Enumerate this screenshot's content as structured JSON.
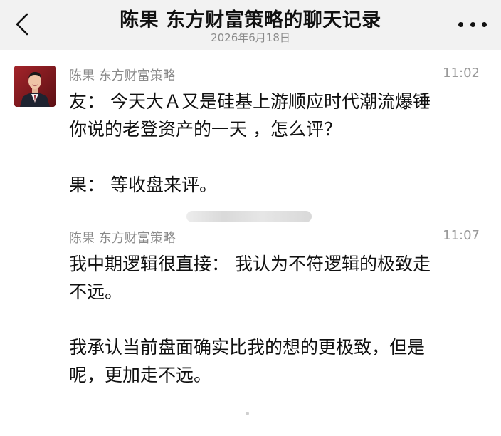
{
  "header": {
    "title": "陈果 东方财富策略的聊天记录",
    "subtitle": "2026年6月18日",
    "back_icon": "chevron-left-icon",
    "more_icon": "more-dots-icon"
  },
  "messages": [
    {
      "sender": "陈果 东方财富策略",
      "time": "11:02",
      "lines": [
        "友：  今天大Ａ又是硅基上游顺应时代潮流爆锤",
        "你说的老登资产的一天 ，怎么评？",
        "",
        "果：  等收盘来评。"
      ]
    },
    {
      "sender": "陈果 东方财富策略",
      "time": "11:07",
      "lines": [
        "我中期逻辑很直接：  我认为不符逻辑的极致走",
        "不远。",
        "",
        "我承认当前盘面确实比我的想的更极致，但是",
        "呢，更加走不远。"
      ]
    }
  ],
  "colors": {
    "header_bg": "#f2f2f2",
    "meta_text": "#8a8a8a",
    "body_text": "#111111"
  }
}
